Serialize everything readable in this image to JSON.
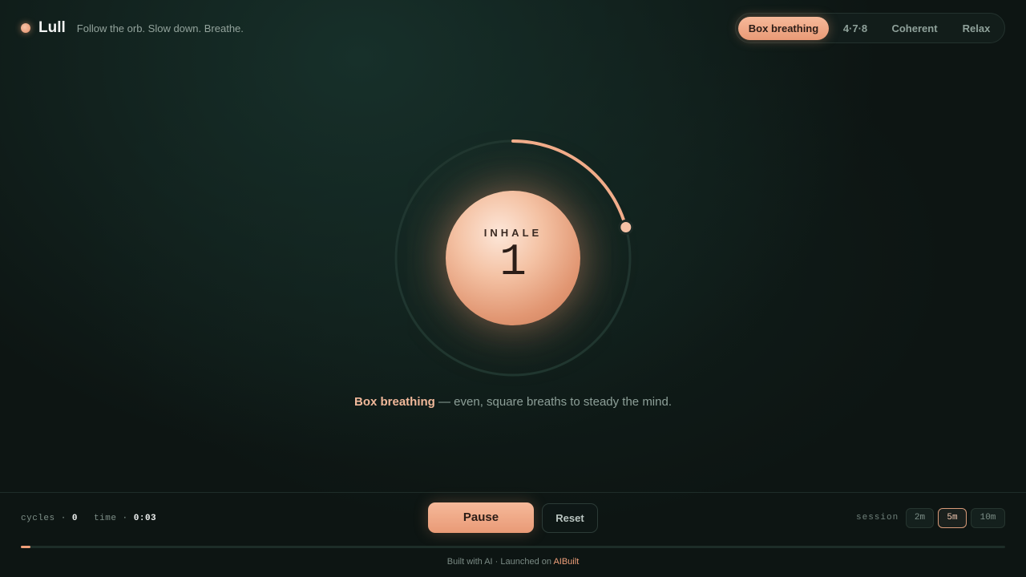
{
  "header": {
    "app_name": "Lull",
    "tagline": "Follow the orb. Slow down. Breathe.",
    "tabs": [
      {
        "label": "Box breathing",
        "active": true
      },
      {
        "label": "4·7·8",
        "active": false
      },
      {
        "label": "Coherent",
        "active": false
      },
      {
        "label": "Relax",
        "active": false
      }
    ]
  },
  "orb": {
    "phase": "INHALE",
    "count": "1",
    "phase_progress": 0.25
  },
  "description": {
    "name": "Box breathing",
    "text": " — even, square breaths to steady the mind."
  },
  "footer": {
    "cycles_label": "cycles ·",
    "cycles_value": "0",
    "time_label": "time ·",
    "time_value": "0:03",
    "pause_label": "Pause",
    "reset_label": "Reset",
    "session_label": "session",
    "session_options": [
      {
        "label": "2m",
        "active": false
      },
      {
        "label": "5m",
        "active": true
      },
      {
        "label": "10m",
        "active": false
      }
    ],
    "session_progress": 0.01
  },
  "credit": {
    "prefix": "Built with AI · Launched on ",
    "link": "AIBuilt"
  },
  "colors": {
    "accent": "#f0a07a",
    "background": "#0d1513"
  }
}
